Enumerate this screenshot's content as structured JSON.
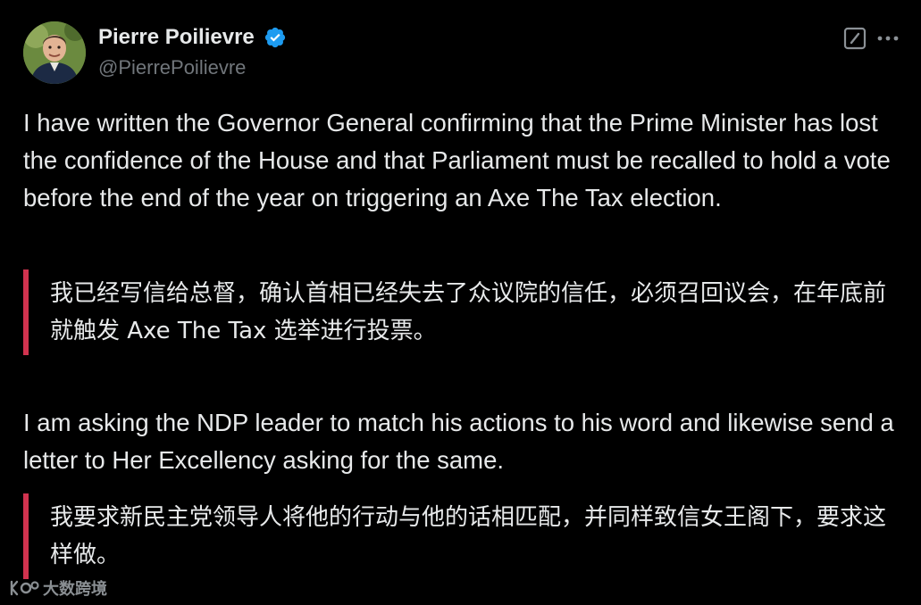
{
  "author": {
    "display_name": "Pierre Poilievre",
    "handle": "@PierrePoilievre",
    "verified": true,
    "verified_color": "#1d9bf0"
  },
  "icons": {
    "grok": "grok-slash-icon",
    "more": "more-horizontal-icon",
    "verified": "verified-badge-icon"
  },
  "post": {
    "paragraph_1": "I have written the Governor General confirming that the Prime Minister has lost the confidence of the House and that Parliament must be recalled to hold a vote before the end of the year on triggering an Axe The Tax election.",
    "translation_1": "我已经写信给总督，确认首相已经失去了众议院的信任，必须召回议会，在年底前就触发 Axe The Tax 选举进行投票。",
    "paragraph_2": "I am asking the NDP leader to match his actions to his word and likewise send a letter to Her Excellency asking for the same.",
    "translation_2": "我要求新民主党领导人将他的行动与他的话相匹配，并同样致信女王阁下，要求这样做。"
  },
  "watermark": {
    "text": "大数跨境"
  },
  "colors": {
    "background": "#000000",
    "text": "#e7e9ea",
    "secondary_text": "#71767b",
    "quote_bar": "#d1334f"
  }
}
